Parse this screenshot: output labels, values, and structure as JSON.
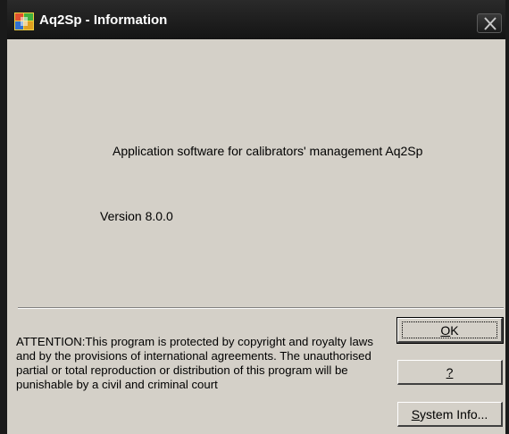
{
  "window": {
    "title": "Aq2Sp - Information",
    "icon": "aq2sp-app-icon",
    "close_icon": "close-icon"
  },
  "content": {
    "app_description": "Application software for calibrators' management Aq2Sp",
    "version": "Version 8.0.0",
    "attention_text": "ATTENTION:This program is protected by copyright and royalty laws and by the provisions of international agreements. The unauthorised partial or total reproduction or distribution of this program will be punishable by a civil and criminal court"
  },
  "buttons": {
    "ok": {
      "mnemonic": "O",
      "rest": "K"
    },
    "help": {
      "mnemonic": "?",
      "rest": ""
    },
    "system_info": {
      "mnemonic": "S",
      "rest": "ystem Info..."
    }
  },
  "colors": {
    "dialog_bg": "#d4d0c8",
    "titlebar_bg": "#141414",
    "title_text": "#ffffff"
  }
}
